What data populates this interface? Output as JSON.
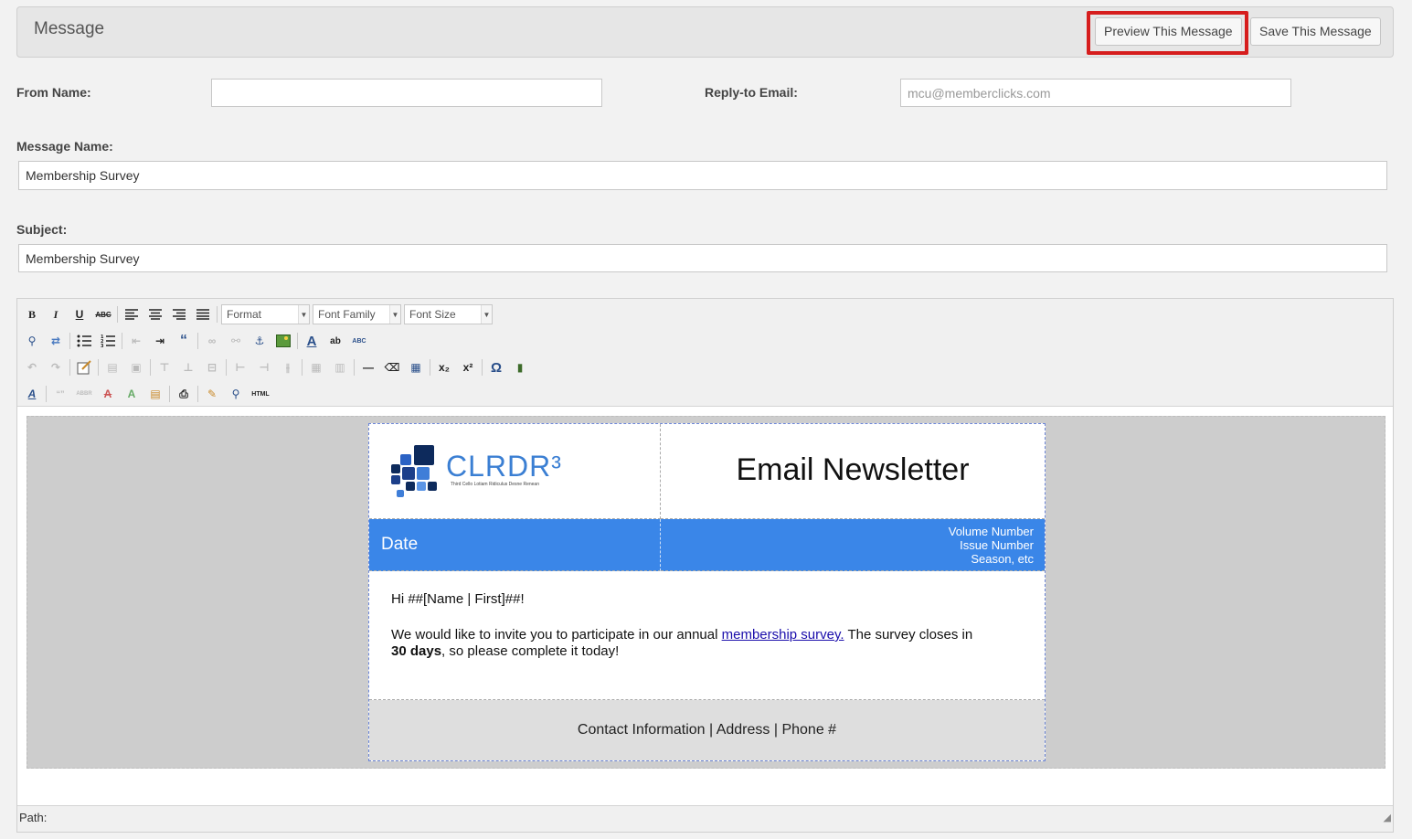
{
  "header": {
    "title": "Message",
    "preview_button": "Preview This Message",
    "save_button": "Save This Message"
  },
  "form": {
    "from_name_label": "From Name:",
    "from_name_value": "",
    "reply_to_label": "Reply-to Email:",
    "reply_to_placeholder": "mcu@memberclicks.com",
    "message_name_label": "Message Name:",
    "message_name_value": "Membership Survey",
    "subject_label": "Subject:",
    "subject_value": "Membership Survey"
  },
  "toolbar": {
    "format_select": "Format",
    "font_family_select": "Font Family",
    "font_size_select": "Font Size",
    "html_button": "HTML"
  },
  "newsletter": {
    "logo_text": "CLRDR³",
    "logo_tagline": "Third Cello Lotiam Ridiculus Desne Renean",
    "title": "Email Newsletter",
    "date_label": "Date",
    "volume_line": "Volume Number",
    "issue_line": "Issue Number",
    "season_line": "Season, etc",
    "greeting": "Hi ##[Name | First]##!",
    "body_before_link": "We would like to invite you to participate in our annual ",
    "link_text": "membership survey.",
    "body_after_link": " The survey closes in",
    "bold_days": "30 days",
    "body_end": ", so please complete it today!",
    "footer": "Contact Information | Address | Phone #",
    "accent_color": "#3a86e8"
  },
  "statusbar": {
    "path_label": "Path:"
  },
  "highlight_color": "#d61d1d"
}
